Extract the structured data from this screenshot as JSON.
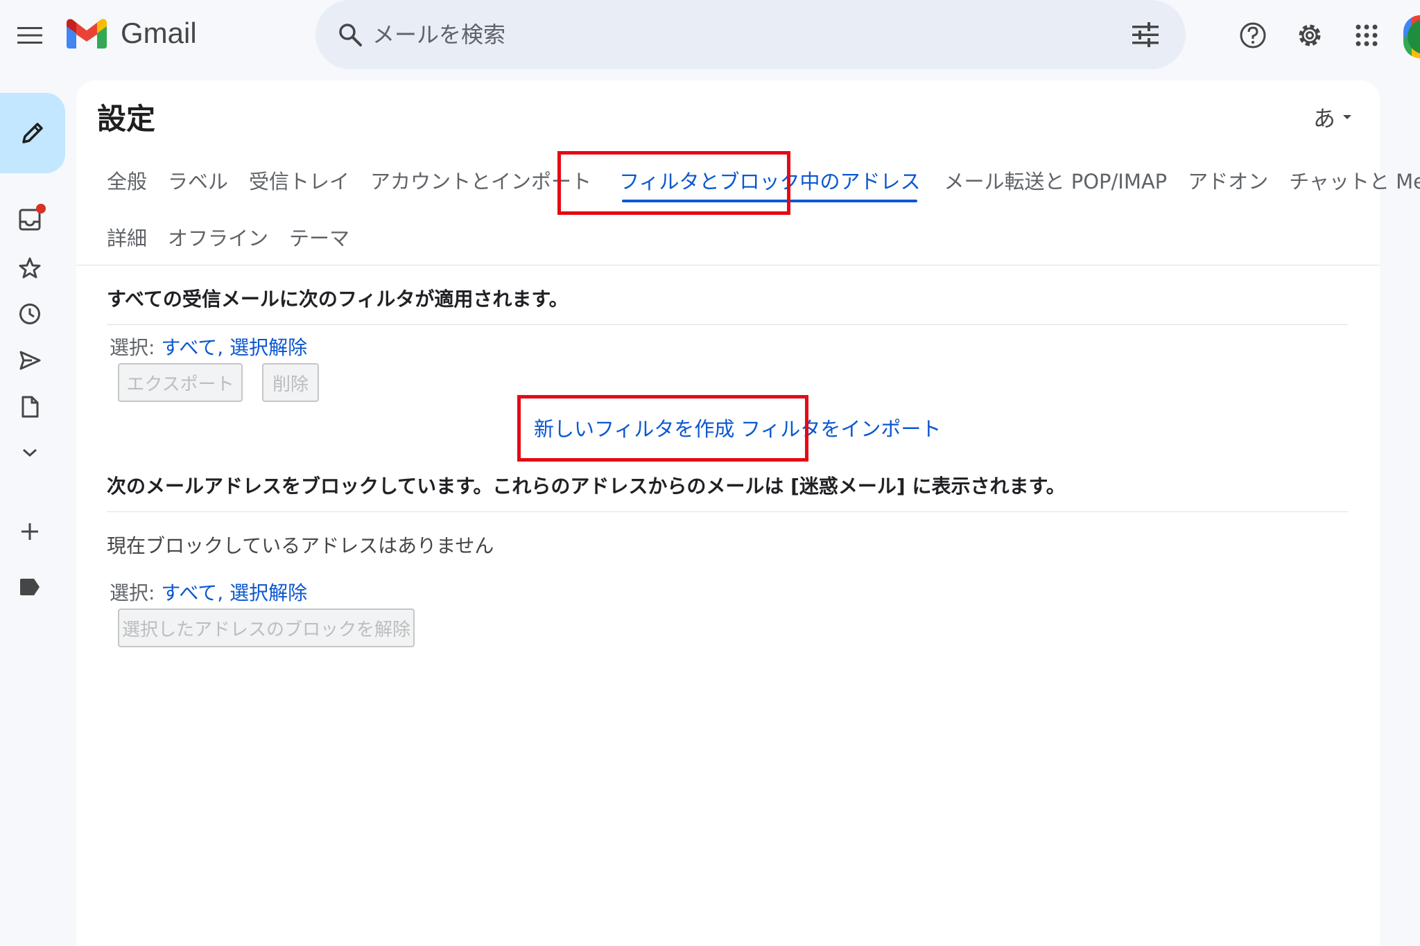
{
  "app": {
    "name": "Gmail"
  },
  "search": {
    "placeholder": "メールを検索"
  },
  "page": {
    "title": "設定",
    "language_indicator": "あ"
  },
  "tabs_row1": [
    "全般",
    "ラベル",
    "受信トレイ",
    "アカウントとインポート",
    "フィルタとブロック中のアドレス",
    "メール転送と POP/IMAP",
    "アドオン",
    "チャットと Meet"
  ],
  "tabs_row2": [
    "詳細",
    "オフライン",
    "テーマ"
  ],
  "active_tab": "フィルタとブロック中のアドレス",
  "filters": {
    "heading": "すべての受信メールに次のフィルタが適用されます。",
    "select_label": "選択:",
    "select_all": "すべて,",
    "select_none": "選択解除",
    "export_button": "エクスポート",
    "delete_button": "削除",
    "create_filter": "新しいフィルタを作成",
    "import_filters": "フィルタをインポート"
  },
  "blocked": {
    "heading": "次のメールアドレスをブロックしています。これらのアドレスからのメールは [迷惑メール] に表示されます。",
    "empty_text": "現在ブロックしているアドレスはありません",
    "select_label": "選択:",
    "select_all": "すべて,",
    "select_none": "選択解除",
    "unblock_button": "選択したアドレスのブロックを解除"
  },
  "colors": {
    "accent": "#0b57d0",
    "highlight": "#e50914",
    "compose": "#c2e7ff"
  }
}
